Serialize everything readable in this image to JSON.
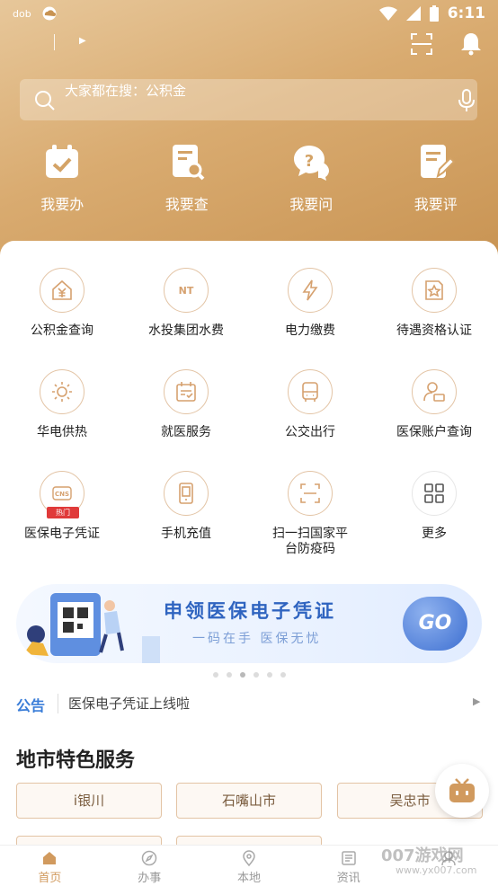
{
  "status_bar": {
    "left_label": "dob",
    "time": "6:11"
  },
  "search": {
    "placeholder": "大家都在搜：公积金"
  },
  "quick_actions": [
    {
      "label": "我要办",
      "icon": "calendar-check-icon"
    },
    {
      "label": "我要查",
      "icon": "document-search-icon"
    },
    {
      "label": "我要问",
      "icon": "question-chat-icon"
    },
    {
      "label": "我要评",
      "icon": "edit-document-icon"
    }
  ],
  "services": [
    {
      "label": "公积金查询",
      "icon": "house-yuan-icon"
    },
    {
      "label": "水投集团水费",
      "icon": "nt-logo-icon"
    },
    {
      "label": "电力缴费",
      "icon": "lightning-icon"
    },
    {
      "label": "待遇资格认证",
      "icon": "badge-star-icon"
    },
    {
      "label": "华电供热",
      "icon": "sun-icon"
    },
    {
      "label": "就医服务",
      "icon": "medical-calendar-icon"
    },
    {
      "label": "公交出行",
      "icon": "bus-icon"
    },
    {
      "label": "医保账户查询",
      "icon": "user-card-icon"
    },
    {
      "label": "医保电子凭证",
      "icon": "cns-icon",
      "badge": "热门",
      "badge_text": "CNS"
    },
    {
      "label": "手机充值",
      "icon": "phone-icon"
    },
    {
      "label": "扫一扫国家平台防疫码",
      "icon": "scan-frame-icon"
    },
    {
      "label": "更多",
      "icon": "grid-more-icon"
    }
  ],
  "banner": {
    "title": "申领医保电子凭证",
    "subtitle": "一码在手 医保无忧",
    "go_label": "GO",
    "dots_count": 6,
    "active_dot": 3
  },
  "notice": {
    "tag": "公告",
    "text": "医保电子凭证上线啦"
  },
  "section_title": "地市特色服务",
  "cities": [
    "i银川",
    "石嘴山市",
    "吴忠市"
  ],
  "tabbar": [
    {
      "label": "首页",
      "active": true,
      "icon": "home-icon"
    },
    {
      "label": "办事",
      "active": false,
      "icon": "compass-icon"
    },
    {
      "label": "本地",
      "active": false,
      "icon": "location-icon"
    },
    {
      "label": "资讯",
      "active": false,
      "icon": "news-icon"
    },
    {
      "label": "",
      "active": false,
      "icon": "user-icon"
    }
  ],
  "watermark": {
    "main": "007游戏网",
    "sub": "www.yx007.com"
  },
  "colors": {
    "accent": "#d19a5e",
    "hero_start": "#e7c79a",
    "hero_end": "#c89352",
    "link_blue": "#3a7dd8"
  }
}
